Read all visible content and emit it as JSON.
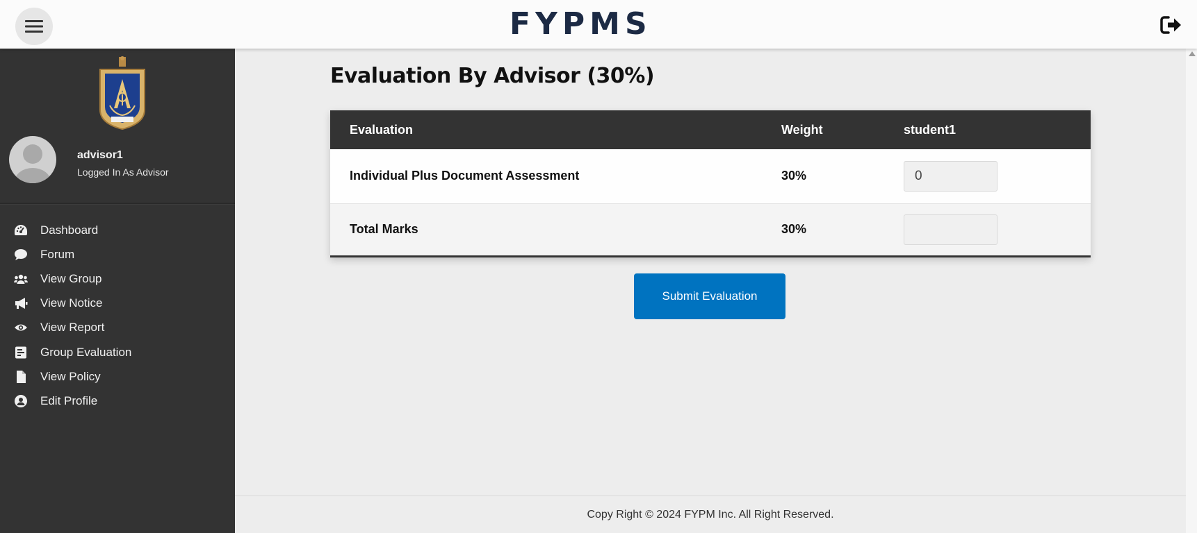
{
  "header": {
    "brand": "FYPMS"
  },
  "user": {
    "name": "advisor1",
    "role": "Logged In As Advisor"
  },
  "sidebar": {
    "items": [
      {
        "label": "Dashboard",
        "icon": "dashboard-icon"
      },
      {
        "label": "Forum",
        "icon": "chat-icon"
      },
      {
        "label": "View Group",
        "icon": "users-icon"
      },
      {
        "label": "View Notice",
        "icon": "megaphone-icon"
      },
      {
        "label": "View Report",
        "icon": "eye-icon"
      },
      {
        "label": "Group Evaluation",
        "icon": "clipboard-icon"
      },
      {
        "label": "View Policy",
        "icon": "file-icon"
      },
      {
        "label": "Edit Profile",
        "icon": "user-circle-icon"
      }
    ]
  },
  "main": {
    "title": "Evaluation By Advisor (30%)",
    "table": {
      "headers": [
        "Evaluation",
        "Weight",
        "student1"
      ],
      "rows": [
        {
          "evaluation": "Individual Plus Document Assessment",
          "weight": "30%",
          "input_value": "0"
        },
        {
          "evaluation": "Total Marks",
          "weight": "30%",
          "input_value": ""
        }
      ]
    },
    "submit_label": "Submit Evaluation"
  },
  "footer": {
    "text": "Copy Right © 2024 FYPM Inc. All Right Reserved."
  },
  "colors": {
    "sidebar_bg": "#333333",
    "header_bg": "#fbfbfb",
    "table_header_bg": "#333333",
    "button_bg": "#0073c0",
    "brand_color": "#1c2a44",
    "crest_gold": "#d9b36a",
    "crest_blue": "#1d3f8e"
  }
}
